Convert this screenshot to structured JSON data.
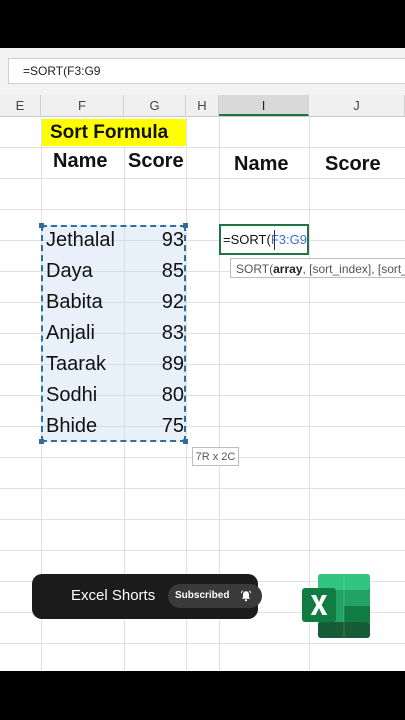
{
  "formula_bar": {
    "text": "=SORT(F3:G9"
  },
  "columns": [
    {
      "id": "E",
      "label": "E"
    },
    {
      "id": "F",
      "label": "F"
    },
    {
      "id": "G",
      "label": "G"
    },
    {
      "id": "H",
      "label": "H"
    },
    {
      "id": "I",
      "label": "I"
    },
    {
      "id": "J",
      "label": "J"
    }
  ],
  "sheet": {
    "title": "Sort Formula",
    "headers": {
      "name": "Name",
      "score": "Score"
    },
    "rows": [
      {
        "name": "Jethalal",
        "score": "93"
      },
      {
        "name": "Daya",
        "score": "85"
      },
      {
        "name": "Babita",
        "score": "92"
      },
      {
        "name": "Anjali",
        "score": "83"
      },
      {
        "name": "Taarak",
        "score": "89"
      },
      {
        "name": "Sodhi",
        "score": "80"
      },
      {
        "name": "Bhide",
        "score": "75"
      }
    ],
    "output_headers": {
      "name": "Name",
      "score": "Score"
    },
    "active_cell": {
      "prefix": "=SORT(",
      "ref": "F3:G9"
    },
    "tooltip": {
      "fn": "SORT(",
      "arg1": "array",
      "rest": ", [sort_index], [sort_order], [by_col])"
    },
    "range_size": "7R x 2C"
  },
  "channel": {
    "name": "Excel Shorts",
    "subscribed_label": "Subscribed"
  },
  "colors": {
    "excel_green": "#217346",
    "title_fill": "#ffff00",
    "range_border": "#2f6e9e"
  }
}
